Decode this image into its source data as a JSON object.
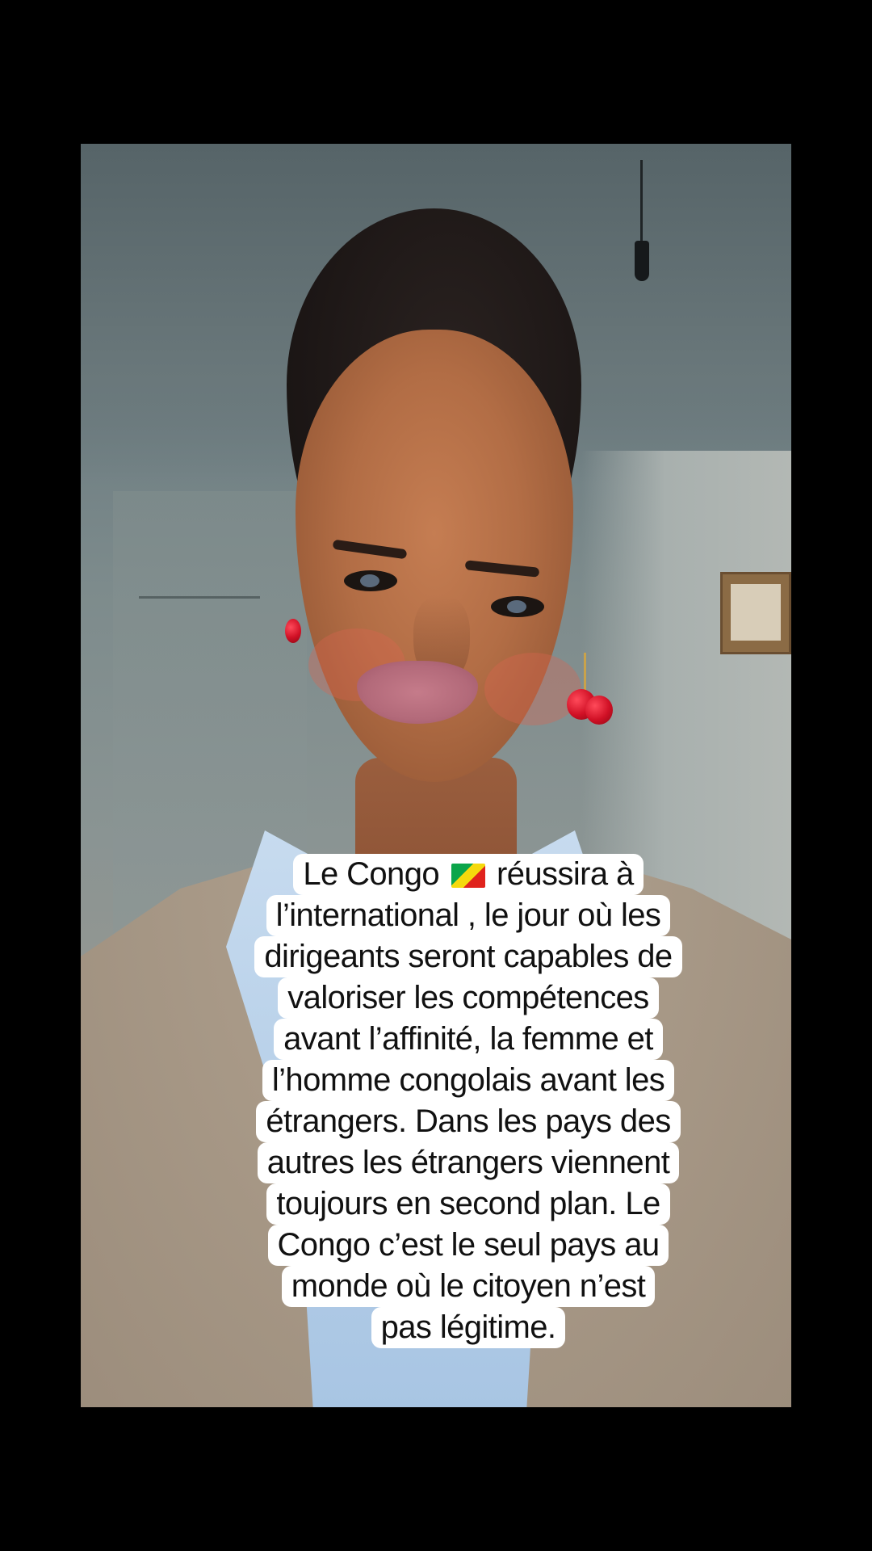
{
  "caption": {
    "lines": [
      "Le Congo",
      "réussira à",
      "l’international , le jour où les",
      "dirigeants seront capables de",
      "valoriser les compétences",
      "avant l’affinité, la femme et",
      "l’homme congolais avant les",
      "étrangers. Dans les pays des",
      "autres les étrangers viennent",
      "toujours en second plan. Le",
      "Congo c’est le seul pays au",
      "monde où le citoyen n’est",
      "pas légitime."
    ],
    "flag_icon": "republic-of-congo-flag-icon",
    "text_color": "#111111",
    "background_color": "#ffffff"
  },
  "colors": {
    "letterbox": "#000000",
    "earring": "#d01025",
    "shirt": "#b6cfe8",
    "coat": "#a99a88"
  }
}
